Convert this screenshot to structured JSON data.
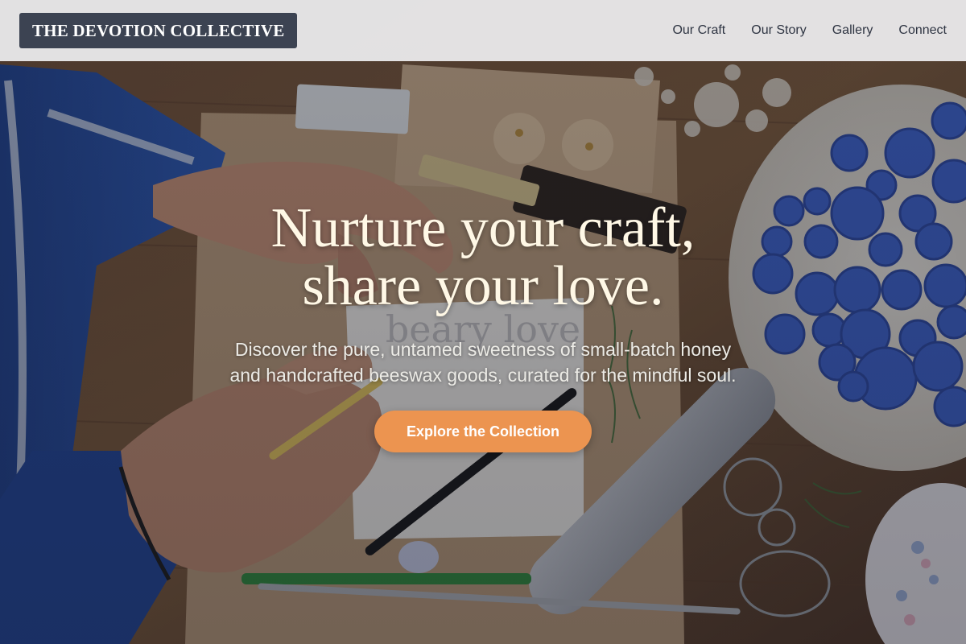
{
  "header": {
    "brand": "THE DEVOTION COLLECTIVE",
    "nav": [
      {
        "label": "Our Craft"
      },
      {
        "label": "Our Story"
      },
      {
        "label": "Gallery"
      },
      {
        "label": "Connect"
      }
    ]
  },
  "hero": {
    "title_line1": "Nurture your craft,",
    "title_line2": "share your love.",
    "subtitle_line1": "Discover the pure, untamed sweetness of small-batch honey",
    "subtitle_line2": "and handcrafted beeswax goods, curated for the mindful soul.",
    "cta_label": "Explore the Collection",
    "background_text": "beary love"
  },
  "colors": {
    "brand_bg": "#3c4352",
    "header_bg": "#eeeef0",
    "nav_text": "#2e3442",
    "cta_bg": "#ec9450",
    "title_text": "#fff8e6",
    "wax_blue": "#3a5fc8"
  }
}
